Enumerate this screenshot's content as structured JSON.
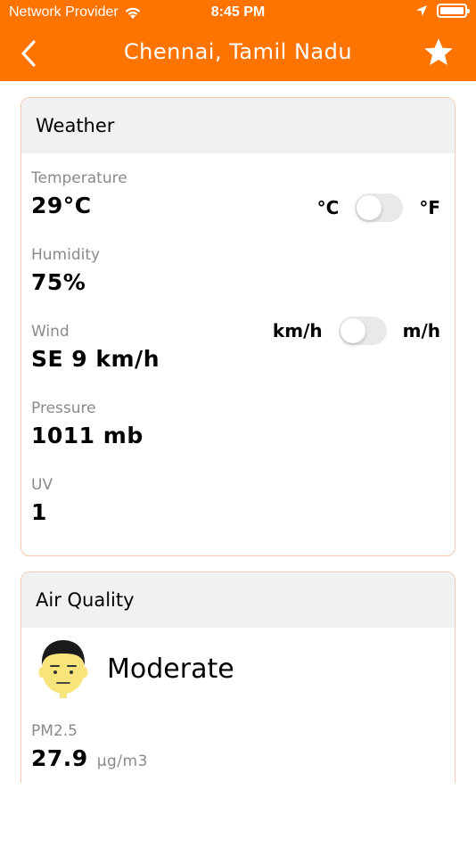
{
  "status_bar": {
    "carrier": "Network Provider",
    "time": "8:45 PM"
  },
  "nav": {
    "title": "Chennai, Tamil Nadu"
  },
  "weather": {
    "heading": "Weather",
    "temperature": {
      "label": "Temperature",
      "value": "29°C",
      "unit_left": "°C",
      "unit_right": "°F"
    },
    "humidity": {
      "label": "Humidity",
      "value": "75%"
    },
    "wind": {
      "label": "Wind",
      "value": "SE 9 km/h",
      "unit_left": "km/h",
      "unit_right": "m/h"
    },
    "pressure": {
      "label": "Pressure",
      "value": "1011 mb"
    },
    "uv": {
      "label": "UV",
      "value": "1"
    }
  },
  "air_quality": {
    "heading": "Air Quality",
    "status": "Moderate",
    "pm25": {
      "label": "PM2.5",
      "value": "27.9",
      "unit": "µg/m3"
    }
  },
  "colors": {
    "accent": "#ff7300",
    "card_border": "#f7c8ad",
    "card_header": "#f1f1f4",
    "label_gray": "#8a8a8a",
    "face": "#f7e47a"
  }
}
